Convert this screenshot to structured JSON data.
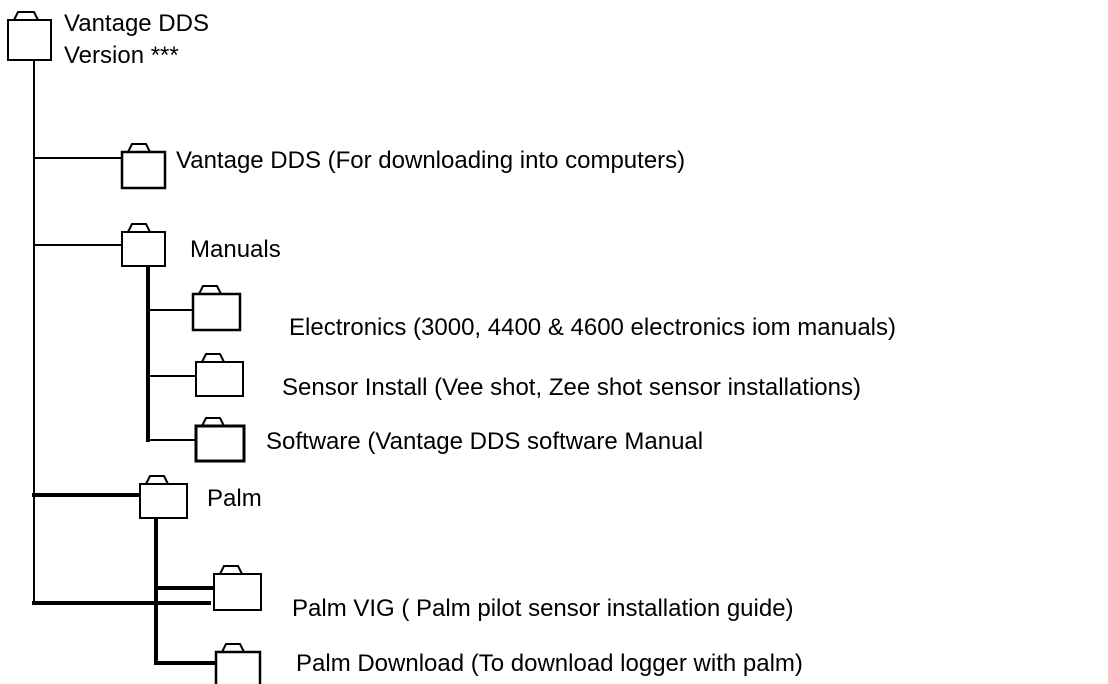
{
  "root": {
    "title": "Vantage DDS",
    "subtitle": "Version ***"
  },
  "nodes": {
    "vantage": {
      "label": "Vantage DDS  (For  downloading into computers)"
    },
    "manuals": {
      "label": "Manuals",
      "children": [
        {
          "label": "Electronics (3000, 4400 & 4600 electronics iom manuals)"
        },
        {
          "label": "Sensor Install (Vee shot, Zee shot sensor installations)"
        },
        {
          "label": "Software (Vantage DDS software Manual"
        }
      ]
    },
    "palm": {
      "label": "Palm",
      "children": [
        {
          "label": "Palm VIG ( Palm pilot sensor installation guide)"
        },
        {
          "label": "Palm Download (To download logger with palm)"
        }
      ]
    }
  }
}
